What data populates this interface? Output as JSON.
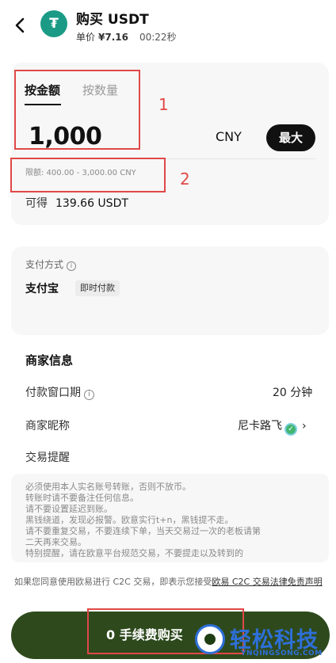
{
  "header": {
    "back_icon": "chevron-left-icon",
    "coin_icon": "tether-coin-icon",
    "coin_symbol": "₮",
    "title": "购买 USDT",
    "price_label": "单价",
    "price_value": "¥7.16",
    "timer": "00:22秒"
  },
  "order": {
    "tabs": [
      {
        "label": "按金额",
        "active": true
      },
      {
        "label": "按数量",
        "active": false
      }
    ],
    "amount": "1,000",
    "currency": "CNY",
    "max_label": "最大",
    "limit_text": "限额: 400.00 - 3,000.00 CNY",
    "receive_label": "可得",
    "receive_value": "139.66 USDT"
  },
  "payment": {
    "label": "支付方式",
    "info_icon": "info-icon",
    "method": "支付宝",
    "badge": "即时付款"
  },
  "merchant": {
    "title": "商家信息",
    "rows": [
      {
        "label": "付款窗口期",
        "value": "20 分钟"
      },
      {
        "label": "商家昵称",
        "value": "尼卡路飞"
      },
      {
        "label": "交易提醒",
        "value": ""
      }
    ],
    "verified_icon": "verified-badge-icon",
    "chevron_icon": "chevron-right-icon"
  },
  "notice": {
    "lines": [
      "必须使用本人实名账号转账，否则不放币。",
      "转账时请不要备注任何信息。",
      "请不要设置延迟到账。",
      "黑钱绕道，发现必报警。欧意实行t+n，黑钱提不走。",
      "请不要重复交易，不要连续下单，当天交易过一次的老板请第",
      "二天再来交易。",
      "特别提醒，请在欧意平台规范交易，不要提走以及转到的"
    ]
  },
  "disclaimer": {
    "text": "如果您同意使用欧易进行 C2C 交易，即表示您接受",
    "link": "欧易 C2C 交易法律免责声明"
  },
  "buy_button": {
    "label": "0 手续费购买"
  },
  "annotations": {
    "label_1": "1",
    "label_2": "2",
    "color": "#e04848"
  },
  "watermark": {
    "text": "轻松科技",
    "sub": "YNQINGSONG.COM",
    "color": "#2e6fd8"
  }
}
